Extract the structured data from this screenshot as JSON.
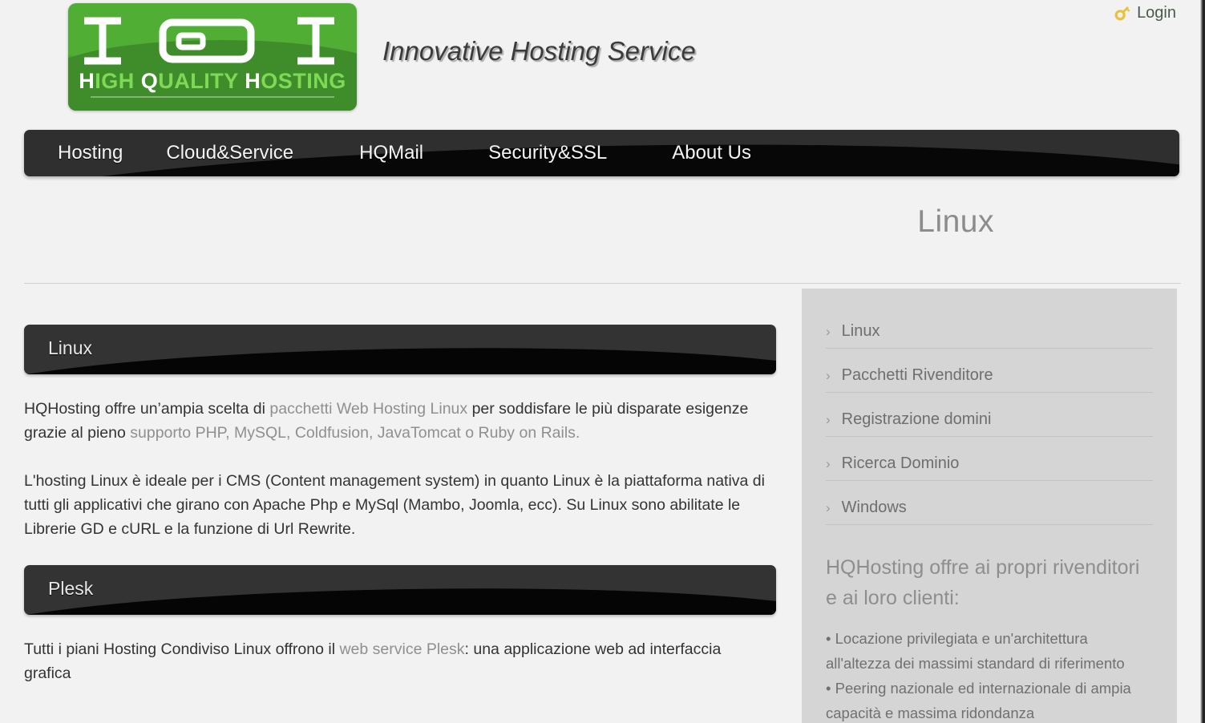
{
  "header": {
    "logo": {
      "mark_text": "HQH",
      "wordmark_pre": "H",
      "wordmark_a": "IGH ",
      "wordmark_q": "Q",
      "wordmark_b": "UALITY ",
      "wordmark_h": "H",
      "wordmark_c": "OSTING",
      "full_wordmark": "HIGH QUALITY HOSTING"
    },
    "tagline": "Innovative Hosting Service",
    "login_label": "Login",
    "login_icon": "key-icon"
  },
  "nav": {
    "items": [
      {
        "label": "Hosting"
      },
      {
        "label": "Cloud&Service"
      },
      {
        "label": "HQMail"
      },
      {
        "label": "Security&SSL"
      },
      {
        "label": "About Us"
      }
    ]
  },
  "page": {
    "title": "Linux"
  },
  "main": {
    "sections": [
      {
        "title": "Linux"
      },
      {
        "title": "Plesk"
      }
    ],
    "paragraph1": {
      "part1": "HQHosting offre un’ampia scelta di ",
      "link1": "pacchetti Web Hosting Linux",
      "part2": " per soddisfare le più disparate esigenze grazie al pieno ",
      "link2": "supporto PHP, MySQL, Coldfusion, JavaTomcat o Ruby on Rails."
    },
    "paragraph2": "L'hosting Linux è ideale per i CMS (Content management system) in quanto Linux è la piattaforma nativa di tutti gli applicativi che girano con Apache Php e MySql (Mambo, Joomla, ecc). Su Linux sono abilitate le Librerie GD e cURL e la funzione di Url Rewrite.",
    "paragraph3": {
      "part1": "Tutti i piani Hosting Condiviso Linux offrono il ",
      "link1": "web service Plesk",
      "part2": ": una applicazione web ad interfaccia grafica"
    }
  },
  "sidebar": {
    "items": [
      {
        "label": "Linux",
        "icon": "chevron-right-icon"
      },
      {
        "label": "Pacchetti Rivenditore",
        "icon": "chevron-right-icon"
      },
      {
        "label": "Registrazione domini",
        "icon": "chevron-right-icon"
      },
      {
        "label": "Ricerca Dominio",
        "icon": "chevron-right-icon"
      },
      {
        "label": "Windows",
        "icon": "chevron-right-icon"
      }
    ],
    "heading": "HQHosting offre ai propri rivenditori e ai loro clienti:",
    "bullets": [
      "• Locazione privilegiata e un'architettura all'altezza dei massimi standard di riferimento",
      "• Peering nazionale ed internazionale di ampia capacità e massima ridondanza"
    ]
  },
  "colors": {
    "brand_green_light": "#4fae33",
    "brand_green_dark": "#3f8d2a",
    "nav_dark": "#2f2f2f",
    "nav_black": "#070707",
    "page_bg": "#f2f2f2",
    "sidebar_bg": "#d5d5d5",
    "link_gray": "#8f8f8f",
    "text_dark": "#333333",
    "login_gold": "#e8c23c"
  }
}
